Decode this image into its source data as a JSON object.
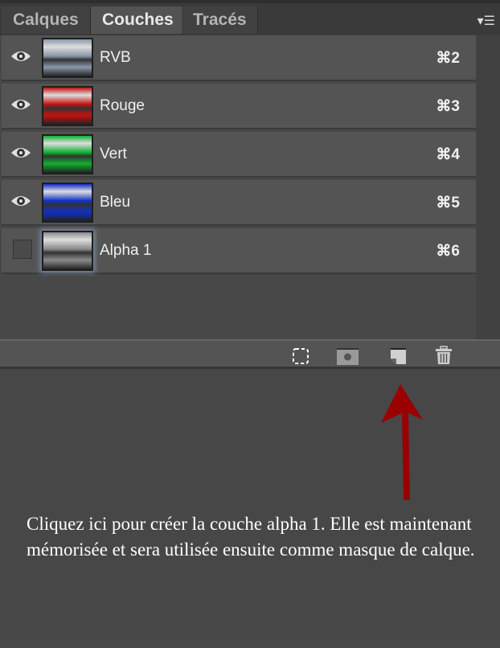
{
  "tabs": [
    {
      "label": "Calques"
    },
    {
      "label": "Couches",
      "active": true
    },
    {
      "label": "Tracés"
    }
  ],
  "panel_menu_icon": "panel-menu-icon",
  "channels": [
    {
      "name": "RVB",
      "shortcut": "⌘2",
      "visible": true,
      "color": "#8a98a8"
    },
    {
      "name": "Rouge",
      "shortcut": "⌘3",
      "visible": true,
      "color": "#c81010"
    },
    {
      "name": "Vert",
      "shortcut": "⌘4",
      "visible": true,
      "color": "#10b030"
    },
    {
      "name": "Bleu",
      "shortcut": "⌘5",
      "visible": true,
      "color": "#1030c8"
    },
    {
      "name": "Alpha 1",
      "shortcut": "⌘6",
      "visible": false,
      "selected": true,
      "color": "#8a8a8a"
    }
  ],
  "footer_icons": [
    "load-selection-icon",
    "save-selection-icon",
    "new-channel-icon",
    "delete-channel-icon"
  ],
  "annotation": {
    "text": "Cliquez ici pour créer la couche alpha 1. Elle est maintenant mémorisée et sera utilisée ensuite comme masque de calque.",
    "arrow_color": "#9a0000"
  }
}
